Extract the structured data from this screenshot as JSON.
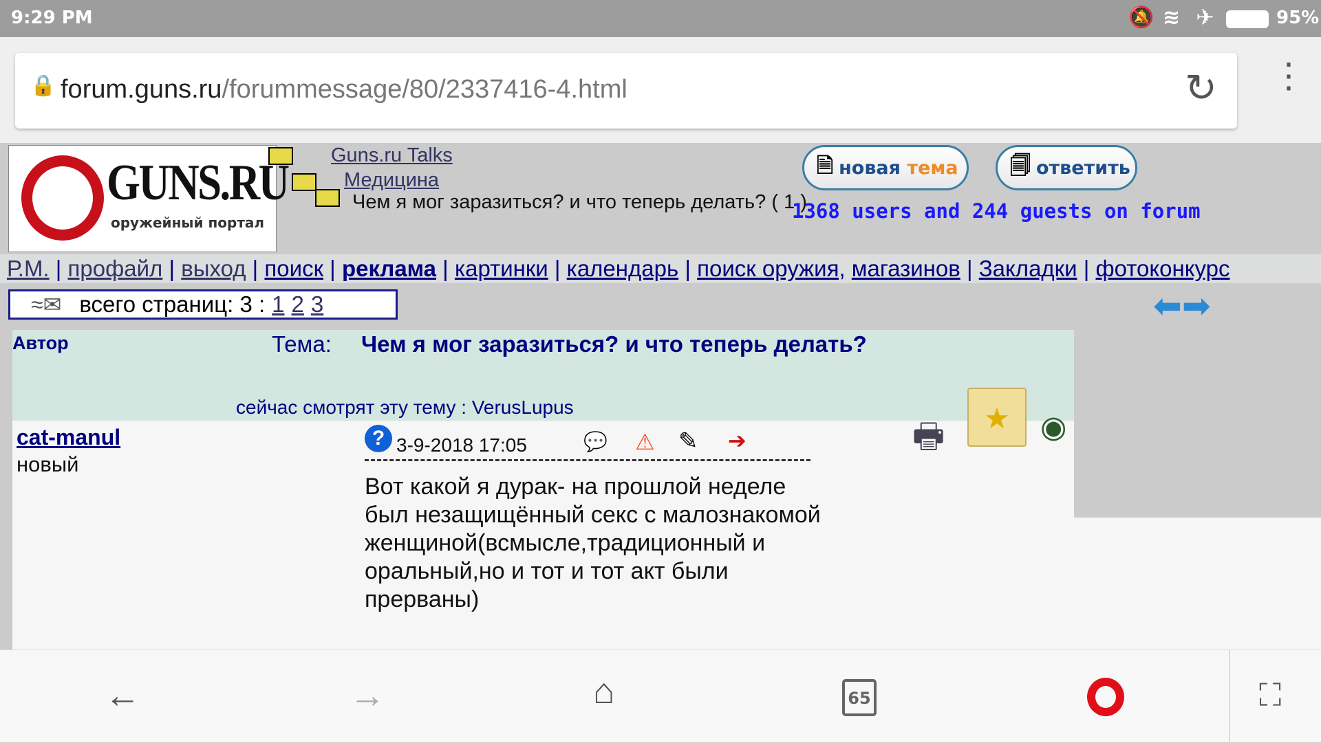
{
  "status": {
    "time": "9:29 PM",
    "battery": "95%"
  },
  "browser": {
    "url_domain": "forum.guns.ru",
    "url_path": "/forummessage/80/2337416-4.html",
    "tabs_count": "65"
  },
  "logo": {
    "brand": "GUNS.RU",
    "tagline": "оружейный портал"
  },
  "breadcrumb": {
    "root": "Guns.ru Talks",
    "section": "Медицина",
    "topic": "Чем я мог заразиться? и что теперь делать? ( 1 )"
  },
  "buttons": {
    "new_topic_1": "новая ",
    "new_topic_2": "тема",
    "reply": "ответить"
  },
  "users_online": "1368 users and 244 guests on forum",
  "nav": [
    "Р.М.",
    "профайл",
    "выход",
    "поиск",
    "реклама",
    "картинки",
    "календарь",
    "поиск оружия,",
    "магазинов",
    "Закладки",
    "фотоконкурс"
  ],
  "pages": {
    "label": "всего страниц: 3 :",
    "items": [
      "1",
      "2",
      "3"
    ]
  },
  "header": {
    "author_label": "Автор",
    "topic_label": "Тема:",
    "topic_title": "Чем я мог заразиться? и что теперь делать?",
    "viewing": "сейчас смотрят эту тему : VerusLupus"
  },
  "post": {
    "author": "cat-manul",
    "rank": "новый",
    "date": "3-9-2018 17:05",
    "body": "Вот какой я дурак- на прошлой неделе был незащищённый секс с малознакомой женщиной(всмысле,традиционный и оральный,но и тот и тот акт были прерваны)"
  },
  "colors": {
    "link": "#000080",
    "online": "#1a1aff",
    "header_bg": "#d4e6e0",
    "accent_orange": "#f08a24"
  }
}
